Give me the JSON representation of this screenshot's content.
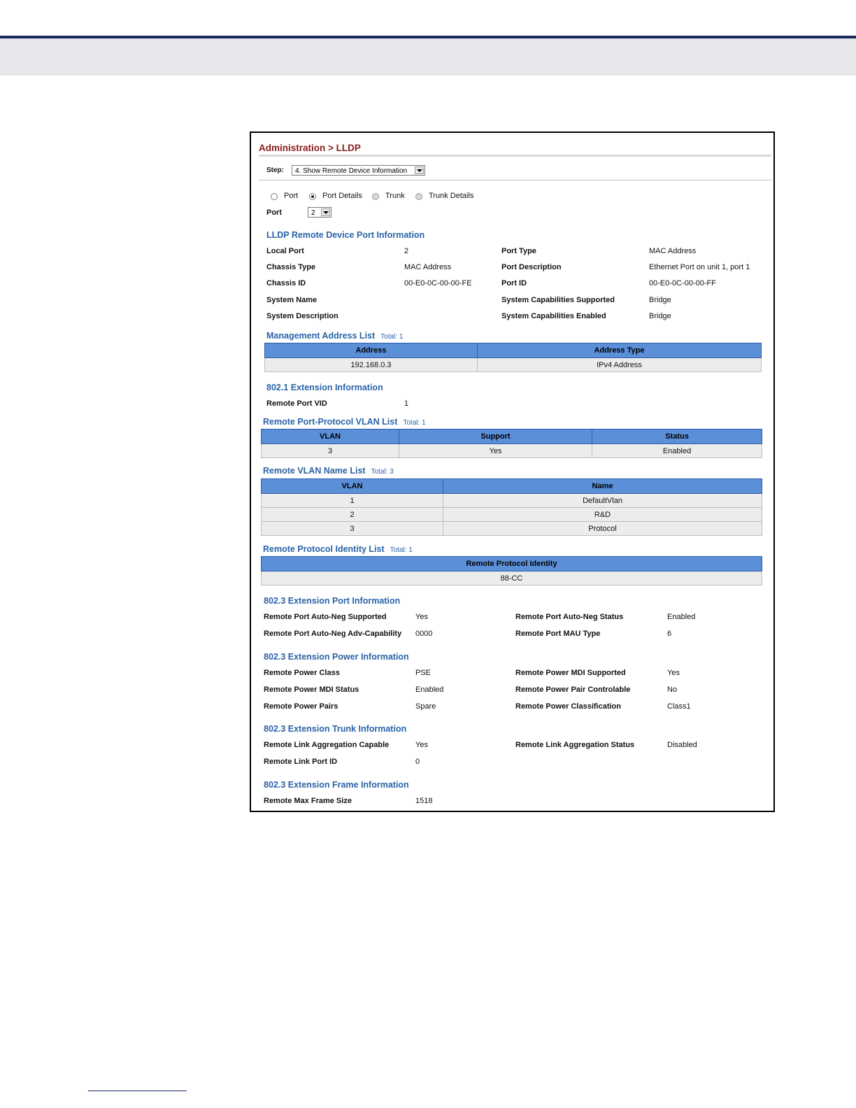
{
  "breadcrumb": "Administration > LLDP",
  "step": {
    "label": "Step:",
    "value": "4. Show Remote Device Information"
  },
  "view_options": [
    {
      "label": "Port",
      "state": "unselected"
    },
    {
      "label": "Port Details",
      "state": "selected"
    },
    {
      "label": "Trunk",
      "state": "disabled"
    },
    {
      "label": "Trunk Details",
      "state": "disabled"
    }
  ],
  "port": {
    "label": "Port",
    "value": "2"
  },
  "port_info": {
    "title": "LLDP Remote Device Port Information",
    "rows": [
      {
        "l1": "Local Port",
        "v1": "2",
        "l2": "Port Type",
        "v2": "MAC Address"
      },
      {
        "l1": "Chassis Type",
        "v1": "MAC Address",
        "l2": "Port Description",
        "v2": "Ethernet Port on unit 1, port 1"
      },
      {
        "l1": "Chassis ID",
        "v1": "00-E0-0C-00-00-FE",
        "l2": "Port ID",
        "v2": "00-E0-0C-00-00-FF"
      },
      {
        "l1": "System Name",
        "v1": "",
        "l2": "System Capabilities Supported",
        "v2": "Bridge"
      },
      {
        "l1": "System Description",
        "v1": "",
        "l2": "System Capabilities Enabled",
        "v2": "Bridge"
      }
    ]
  },
  "mgmt_list": {
    "title": "Management Address List",
    "total": "Total: 1",
    "headers": [
      "Address",
      "Address Type"
    ],
    "rows": [
      [
        "192.168.0.3",
        "IPv4 Address"
      ]
    ]
  },
  "ext_8021": {
    "title": "802.1 Extension Information",
    "rows": [
      {
        "l1": "Remote Port VID",
        "v1": "1"
      }
    ]
  },
  "ppvlan_list": {
    "title": "Remote Port-Protocol VLAN List",
    "total": "Total: 1",
    "headers": [
      "VLAN",
      "Support",
      "Status"
    ],
    "rows": [
      [
        "3",
        "Yes",
        "Enabled"
      ]
    ]
  },
  "vlan_name_list": {
    "title": "Remote VLAN Name List",
    "total": "Total: 3",
    "headers": [
      "VLAN",
      "Name"
    ],
    "rows": [
      [
        "1",
        "DefaultVlan"
      ],
      [
        "2",
        "R&D"
      ],
      [
        "3",
        "Protocol"
      ]
    ]
  },
  "protocol_id_list": {
    "title": "Remote Protocol Identity List",
    "total": "Total: 1",
    "headers": [
      "Remote Protocol Identity"
    ],
    "rows": [
      [
        "88-CC"
      ]
    ]
  },
  "ext_8023_port": {
    "title": "802.3 Extension Port Information",
    "rows": [
      {
        "l1": "Remote Port Auto-Neg Supported",
        "v1": "Yes",
        "l2": "Remote Port Auto-Neg Status",
        "v2": "Enabled"
      },
      {
        "l1": "Remote Port Auto-Neg Adv-Capability",
        "v1": "0000",
        "l2": "Remote Port MAU Type",
        "v2": "6"
      }
    ]
  },
  "ext_8023_power": {
    "title": "802.3 Extension Power Information",
    "rows": [
      {
        "l1": "Remote Power Class",
        "v1": "PSE",
        "l2": "Remote Power MDI Supported",
        "v2": "Yes"
      },
      {
        "l1": "Remote Power MDI Status",
        "v1": "Enabled",
        "l2": "Remote Power Pair Controlable",
        "v2": "No"
      },
      {
        "l1": "Remote Power Pairs",
        "v1": "Spare",
        "l2": "Remote Power Classification",
        "v2": "Class1"
      }
    ]
  },
  "ext_8023_trunk": {
    "title": "802.3 Extension Trunk Information",
    "rows": [
      {
        "l1": "Remote Link Aggregation Capable",
        "v1": "Yes",
        "l2": "Remote Link Aggregation Status",
        "v2": "Disabled"
      },
      {
        "l1": "Remote Link Port ID",
        "v1": "0",
        "l2": "",
        "v2": ""
      }
    ]
  },
  "ext_8023_frame": {
    "title": "802.3 Extension Frame Information",
    "rows": [
      {
        "l1": "Remote Max Frame Size",
        "v1": "1518"
      }
    ]
  }
}
